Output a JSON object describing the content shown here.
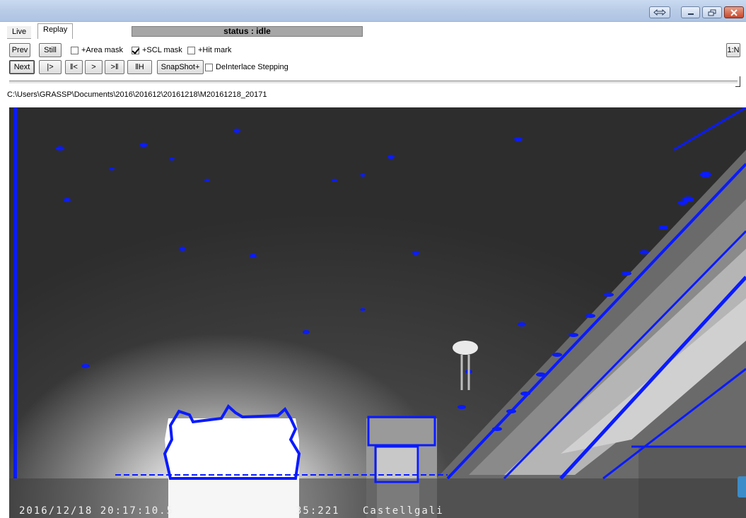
{
  "window": {
    "controls": [
      "restore-arrows-icon",
      "minimize-icon",
      "maximize-icon",
      "close-icon"
    ]
  },
  "tabs": [
    {
      "label": "Live",
      "active": false
    },
    {
      "label": "Replay",
      "active": true
    }
  ],
  "status": "status : idle",
  "toolbar": {
    "prev": "Prev",
    "still": "Still",
    "next": "Next",
    "play": "|>",
    "step_back": "‖<",
    "step_fwd": ">",
    "end": ">‖",
    "hold": "‖H",
    "snapshot": "SnapShot+",
    "ratio": "1:N"
  },
  "checkboxes": {
    "area_mask": {
      "label": "+Area mask",
      "checked": false
    },
    "scl_mask": {
      "label": "+SCL mask",
      "checked": true
    },
    "hit_mark": {
      "label": "+Hit mark",
      "checked": false
    },
    "deinterlace": {
      "label": "DeInterlace Stepping",
      "checked": false
    }
  },
  "slider": {
    "position": 1.0
  },
  "file_path": "C:\\Users\\GRASSP\\Documents\\2016\\201612\\20161218\\M20161218_20171",
  "osd": {
    "timestamp": "2016/12/18 20:17:10.5",
    "coords": "35:221",
    "location": "Castellgali"
  },
  "colors": {
    "overlay": "#0a1bff",
    "titlebar": "#b9cce7",
    "status_bg": "#a6a6a6"
  }
}
